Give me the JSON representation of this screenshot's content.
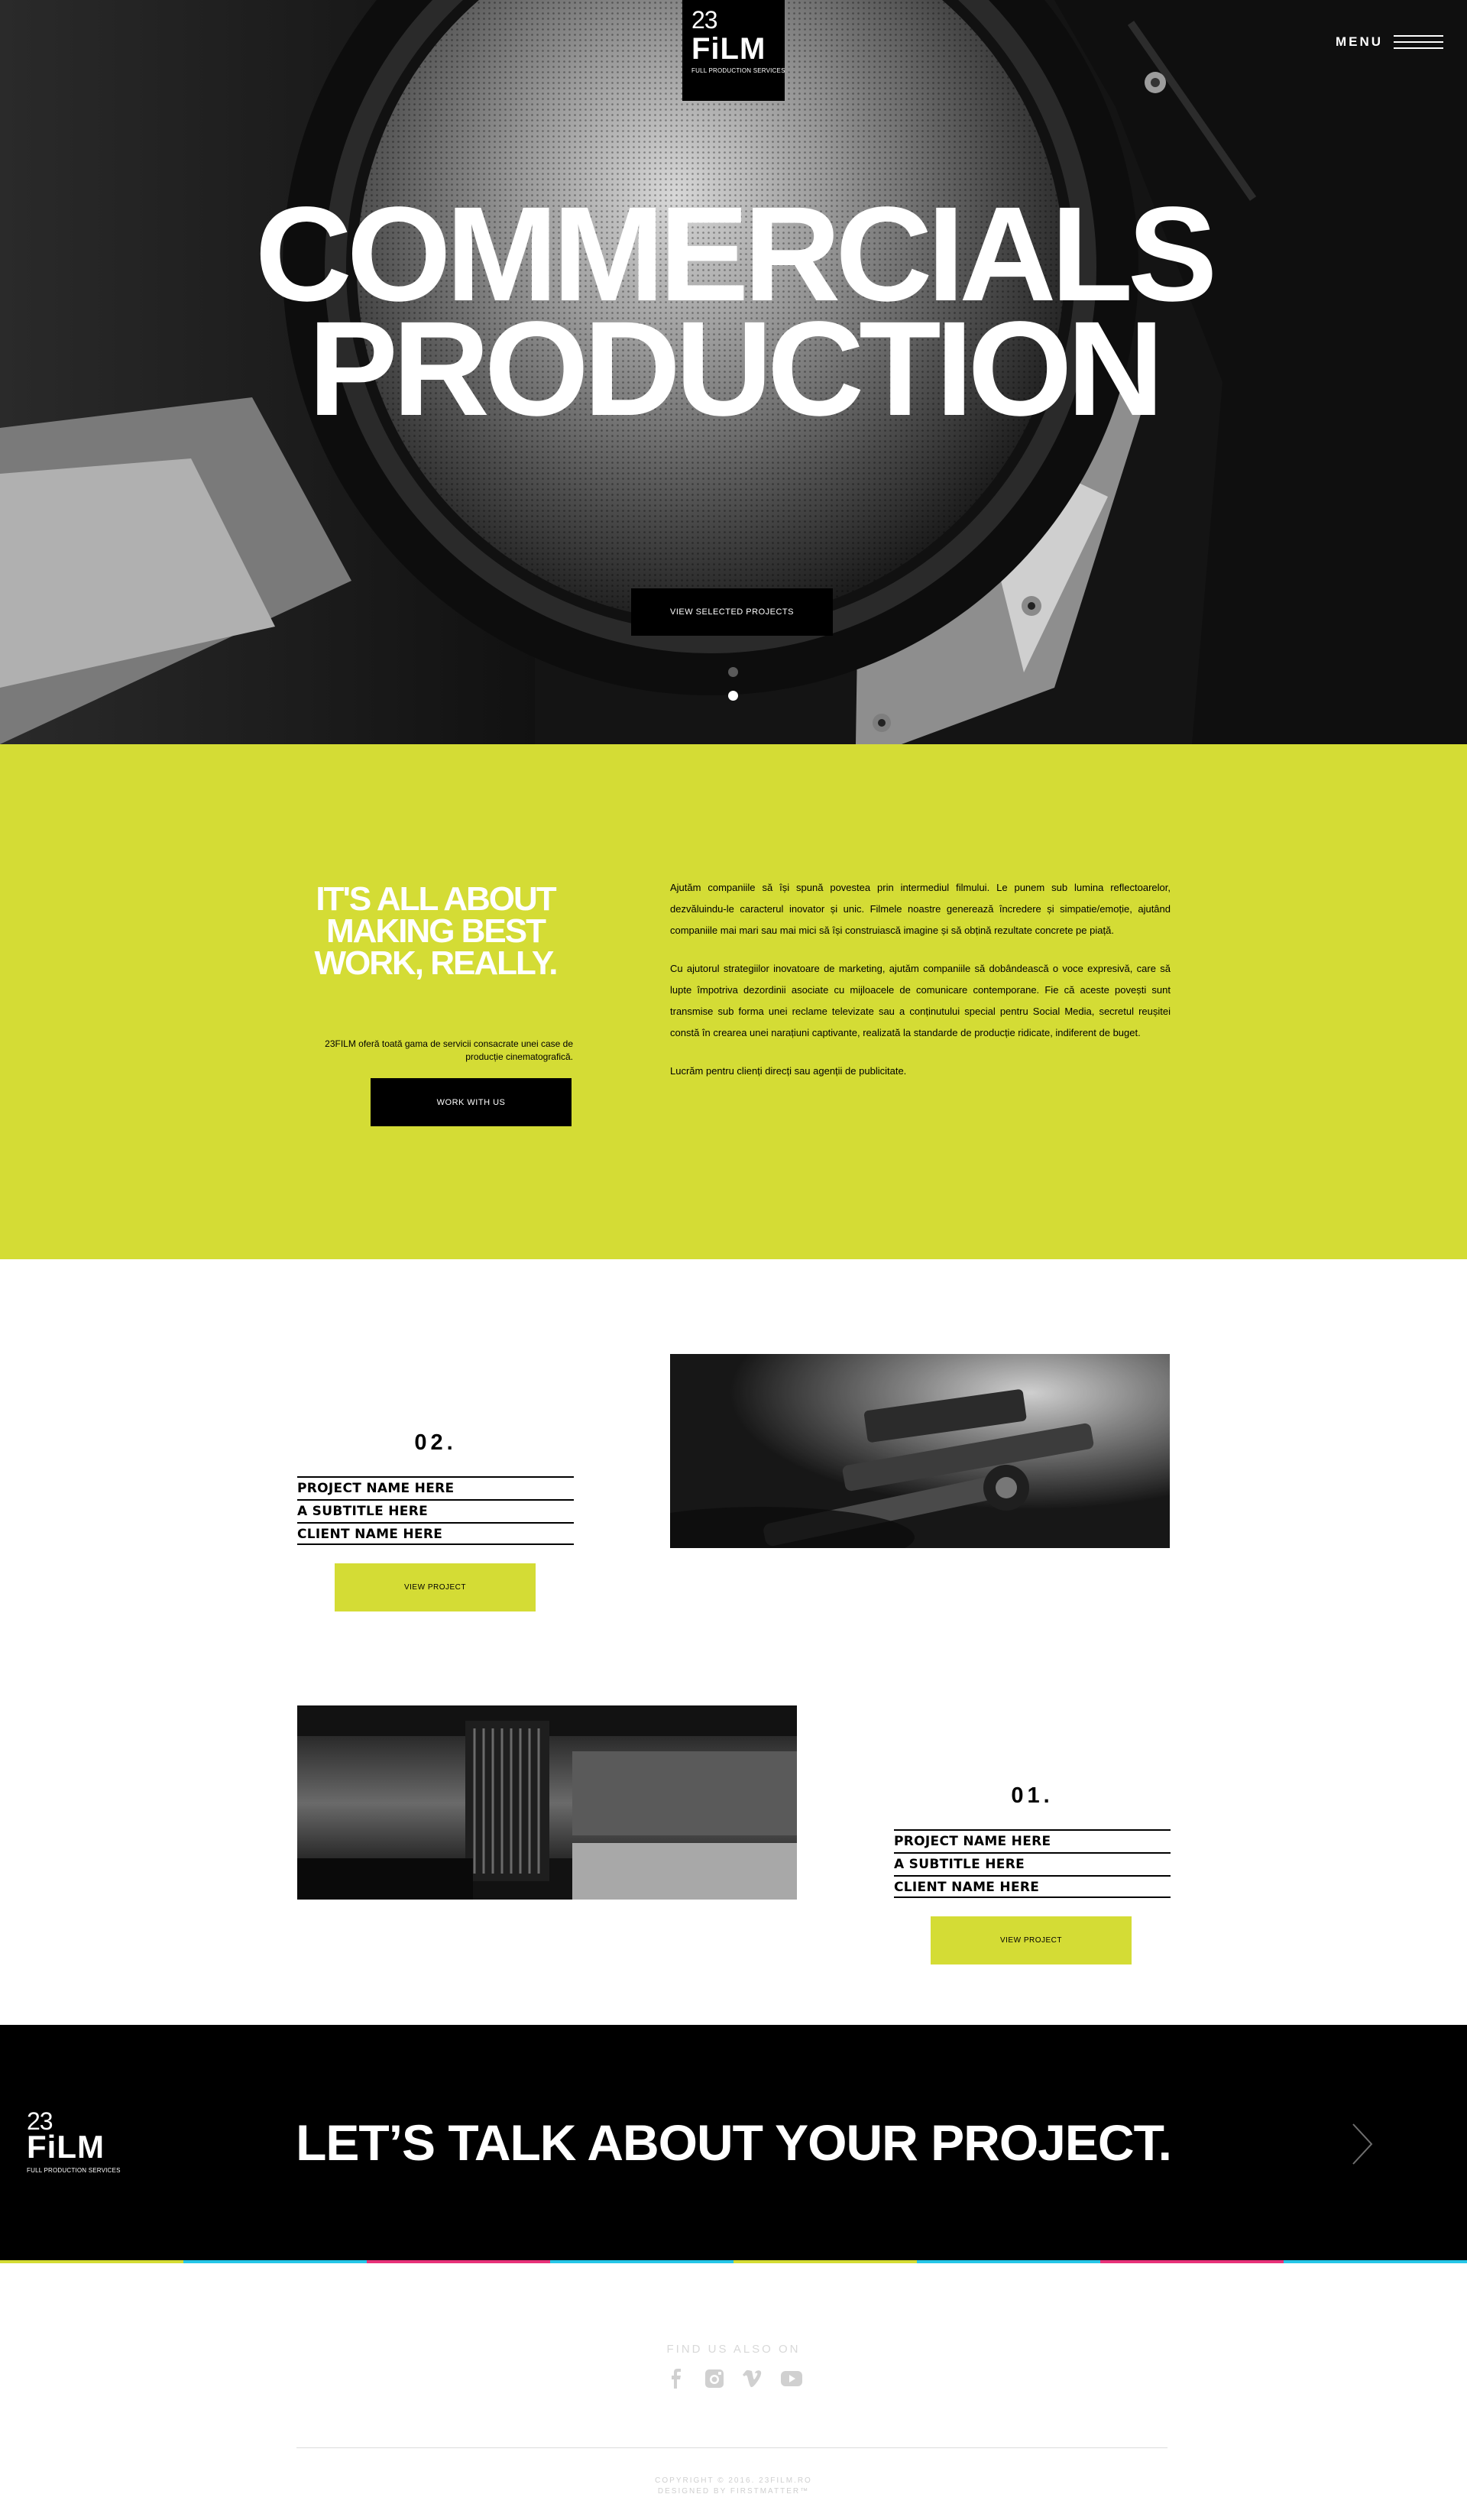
{
  "brand": {
    "logo_number": "23",
    "logo_word": "FiLM",
    "logo_tagline": "FULL PRODUCTION SERVICES"
  },
  "nav": {
    "menu_label": "MENU",
    "menu_icon": "hamburger-icon"
  },
  "hero": {
    "title_line1": "COMMERCIALS",
    "title_line2": "PRODUCTION",
    "button_label": "VIEW SELECTED PROJECTS",
    "slides_total": 2,
    "active_slide": 2
  },
  "about": {
    "heading_line1": "IT'S ALL ABOUT",
    "heading_line2": "MAKING BEST",
    "heading_line3": "WORK, REALLY.",
    "lead": "23FILM oferă toată gama de servicii consacrate unei case de producție cinematografică.",
    "button_label": "WORK WITH US",
    "paragraph1": "Ajutăm companiile să își spună povestea prin intermediul filmului. Le punem sub lumina reflectoarelor, dezvăluindu-le caracterul inovator și unic. Filmele noastre generează încredere și simpatie/emoție, ajutând companiile mai mari sau mai mici să își construiască imagine și să obțină rezultate concrete pe piață.",
    "paragraph2": "Cu ajutorul strategiilor inovatoare de marketing, ajutăm companiile să dobândească o voce expresivă, care să lupte împotriva dezordinii asociate cu mijloacele de comunicare contemporane. Fie că aceste povești sunt transmise sub forma unei reclame televizate sau a conținutului special pentru Social Media, secretul reușitei constă în crearea unei narațiuni captivante, realizată la standarde de producție ridicate, indiferent de buget.",
    "paragraph3": "Lucrăm pentru clienți direcți sau agenții de publicitate."
  },
  "projects": [
    {
      "number": "02.",
      "name": "PROJECT NAME HERE",
      "subtitle": "A SUBTITLE HERE",
      "client": "CLIENT NAME HERE",
      "button_label": "VIEW PROJECT"
    },
    {
      "number": "01.",
      "name": "PROJECT NAME HERE",
      "subtitle": "A SUBTITLE HERE",
      "client": "CLIENT NAME HERE",
      "button_label": "VIEW PROJECT"
    }
  ],
  "cta": {
    "title": "LET’S TALK ABOUT YOUR PROJECT.",
    "arrow_icon": "chevron-right-icon"
  },
  "footer": {
    "find_label": "FIND US ALSO ON",
    "socials": [
      "facebook-icon",
      "instagram-icon",
      "vimeo-icon",
      "youtube-icon"
    ],
    "copyright": "COPYRIGHT © 2016. 23FILM.RO",
    "designer": "DESIGNED BY FIRSTMATTER™"
  },
  "colors": {
    "accent": "#d4dc35",
    "black": "#000000",
    "white": "#ffffff",
    "stripe": [
      "#d4dc35",
      "#26c6e8",
      "#e8327a",
      "#26c6e8",
      "#d4dc35",
      "#26c6e8",
      "#e8327a",
      "#26c6e8"
    ]
  }
}
